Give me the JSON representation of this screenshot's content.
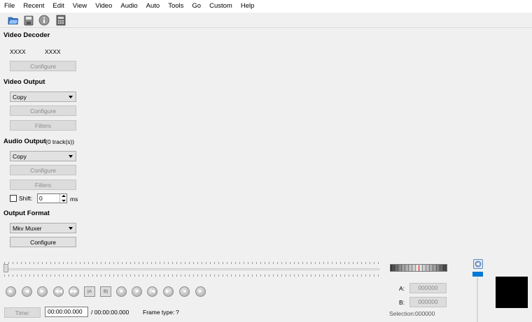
{
  "menubar": {
    "items": [
      "File",
      "Recent",
      "Edit",
      "View",
      "Video",
      "Audio",
      "Auto",
      "Tools",
      "Go",
      "Custom",
      "Help"
    ]
  },
  "toolbar": {
    "icons": [
      "open-folder-icon",
      "save-disk-icon",
      "info-icon",
      "calculator-icon"
    ]
  },
  "video_decoder": {
    "title": "Video Decoder",
    "codec_left": "XXXX",
    "codec_right": "XXXX",
    "configure_label": "Configure"
  },
  "video_output": {
    "title": "Video Output",
    "selected": "Copy",
    "configure_label": "Configure",
    "filters_label": "Filters"
  },
  "audio_output": {
    "title": "Audio Output",
    "tracks": "(0 track(s))",
    "selected": "Copy",
    "configure_label": "Configure",
    "filters_label": "Filters",
    "shift_label": "Shift:",
    "shift_checked": false,
    "shift_value": "0",
    "shift_unit": "ms"
  },
  "output_format": {
    "title": "Output Format",
    "selected": "Mkv Muxer",
    "configure_label": "Configure"
  },
  "transport": {
    "buttons": [
      "play",
      "rewind",
      "forward",
      "prev-frame",
      "next-frame",
      "set-marker-a",
      "set-marker-b",
      "prev-black",
      "next-black",
      "go-first",
      "go-last",
      "prev-cut",
      "next-cut"
    ]
  },
  "status": {
    "time_button": "Time:",
    "current_time": "00:00:00.000",
    "total_time": "/ 00:00:00.000",
    "frame_type_label": "Frame type:",
    "frame_type_value": "?"
  },
  "markers": {
    "a_label": "A:",
    "a_value": "000000",
    "b_label": "B:",
    "b_value": "000000",
    "selection_label": "Selection:",
    "selection_value": "000000"
  },
  "colors": {
    "volume_handle": "#0078d7",
    "jog_center": "#d00000",
    "preview": "#000000"
  }
}
